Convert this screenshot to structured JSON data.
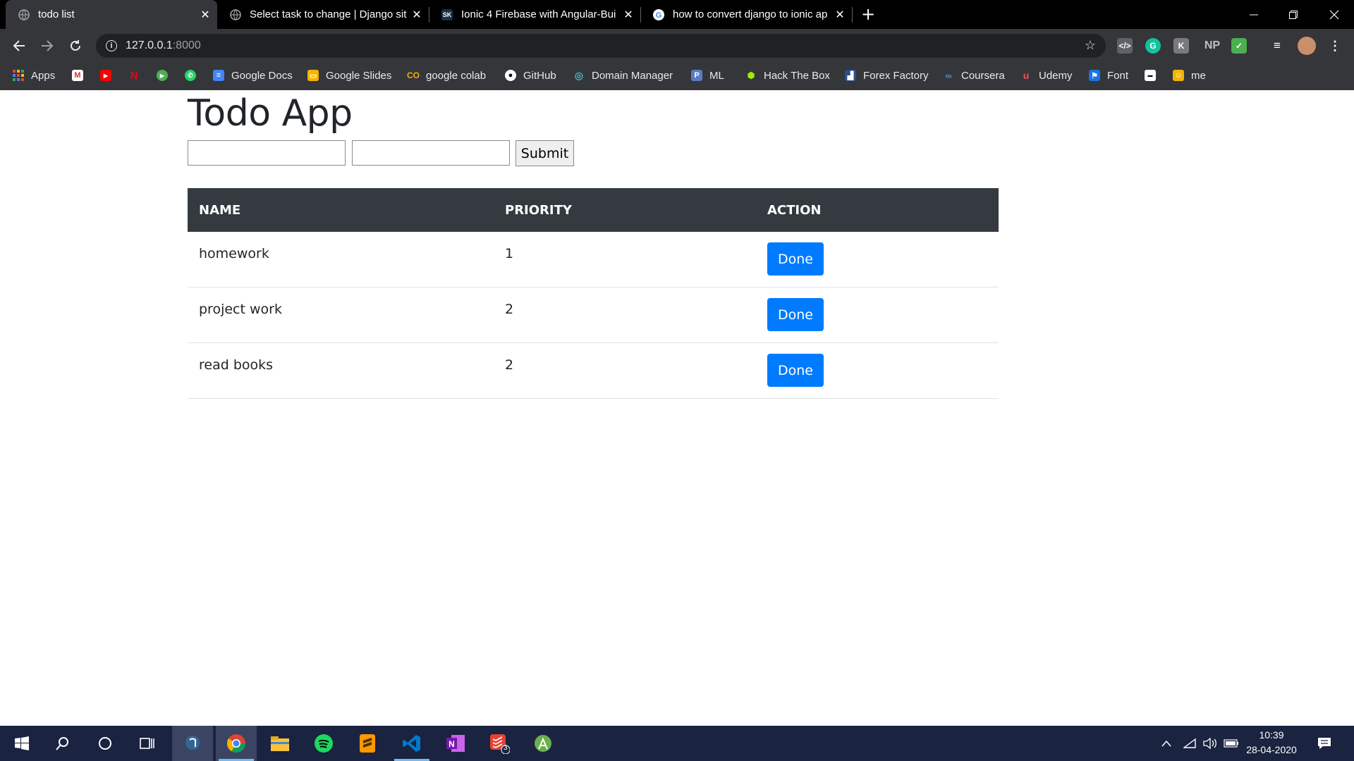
{
  "browser": {
    "tabs": [
      {
        "title": "todo list",
        "icon": "globe-icon",
        "active": true
      },
      {
        "title": "Select task to change | Django sit",
        "icon": "globe-icon",
        "active": false
      },
      {
        "title": "Ionic 4 Firebase with Angular-Bui",
        "icon": "sk-icon",
        "active": false
      },
      {
        "title": "how to convert django to ionic ap",
        "icon": "google-icon",
        "active": false
      }
    ],
    "new_tab_label": "+",
    "close_label": "✕",
    "address": {
      "host": "127.0.0.1",
      "port": ":8000"
    },
    "extensions": [
      "code-icon",
      "grammarly-icon",
      "k-icon",
      "NP",
      "check-icon"
    ],
    "bookmarks": [
      {
        "label": "Apps",
        "icon": "apps-grid-icon"
      },
      {
        "label": "",
        "icon": "gmail-icon"
      },
      {
        "label": "",
        "icon": "youtube-icon"
      },
      {
        "label": "",
        "icon": "netflix-icon"
      },
      {
        "label": "",
        "icon": "play-icon"
      },
      {
        "label": "",
        "icon": "whatsapp-icon"
      },
      {
        "label": "Google Docs",
        "icon": "docs-icon"
      },
      {
        "label": "Google Slides",
        "icon": "slides-icon"
      },
      {
        "label": "google colab",
        "icon": "colab-icon"
      },
      {
        "label": "GitHub",
        "icon": "github-icon"
      },
      {
        "label": "Domain Manager",
        "icon": "domain-icon"
      },
      {
        "label": "ML",
        "icon": "p-icon"
      },
      {
        "label": "Hack The Box",
        "icon": "htb-icon"
      },
      {
        "label": "Forex Factory",
        "icon": "forex-icon"
      },
      {
        "label": "Coursera",
        "icon": "coursera-icon"
      },
      {
        "label": "Udemy",
        "icon": "udemy-icon"
      },
      {
        "label": "Font",
        "icon": "flag-icon"
      },
      {
        "label": "",
        "icon": "tag-icon"
      },
      {
        "label": "me",
        "icon": "me-icon"
      }
    ]
  },
  "app": {
    "title": "Todo App",
    "form": {
      "name_value": "",
      "priority_value": "",
      "submit_label": "Submit"
    },
    "table": {
      "headers": [
        "NAME",
        "PRIORITY",
        "ACTION"
      ],
      "rows": [
        {
          "name": "homework",
          "priority": "1",
          "action": "Done"
        },
        {
          "name": "project work",
          "priority": "2",
          "action": "Done"
        },
        {
          "name": "read books",
          "priority": "2",
          "action": "Done"
        }
      ]
    }
  },
  "taskbar": {
    "time": "10:39",
    "date": "28-04-2020",
    "todoist_badge": "3"
  },
  "colors": {
    "primary_button": "#007bff",
    "table_header": "#343a40",
    "taskbar": "#1a2340"
  }
}
